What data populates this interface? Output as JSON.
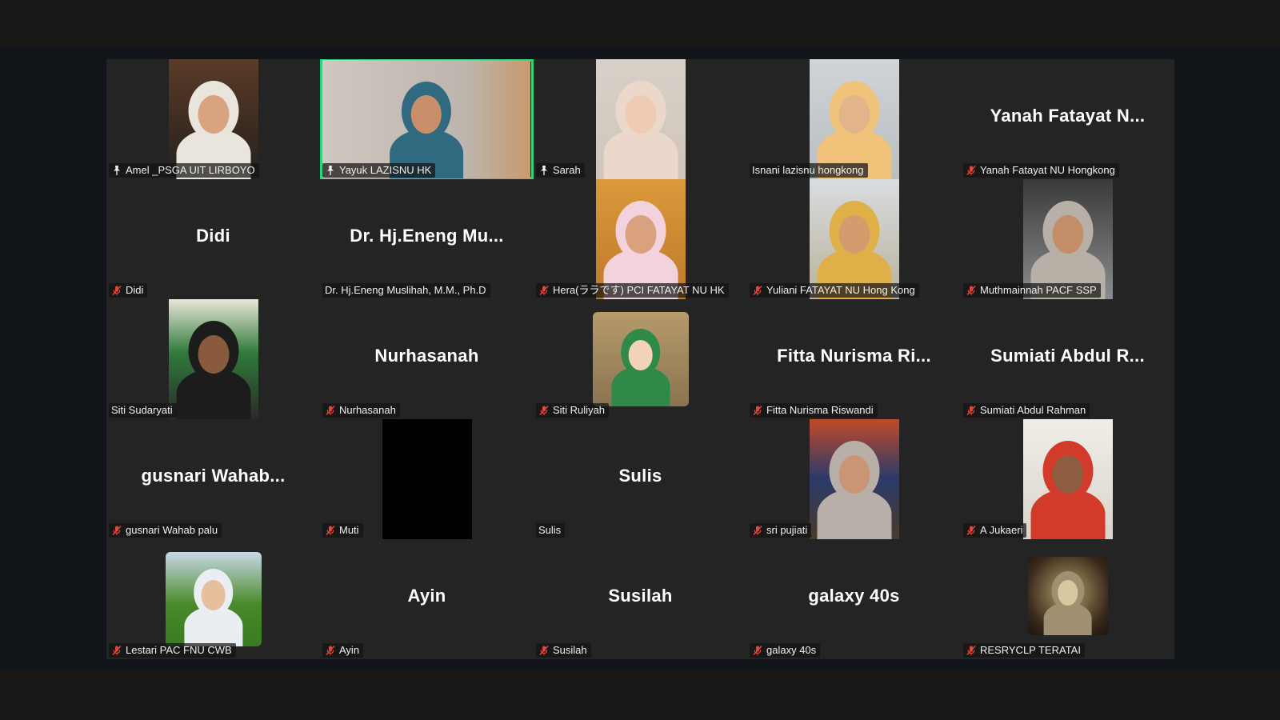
{
  "colors": {
    "active_speaker": "#2ad47a",
    "mute": "#e0463c",
    "tile_bg": "#242424"
  },
  "participants": [
    {
      "label": "Amel _PSGA UIT LIRBOYO",
      "big": "",
      "icon": "pin-icon",
      "video": "portrait"
    },
    {
      "label": "Yayuk LAZISNU HK",
      "big": "",
      "icon": "pin-icon",
      "video": "wide",
      "active": true
    },
    {
      "label": "Sarah",
      "big": "",
      "icon": "pin-icon",
      "video": "portrait"
    },
    {
      "label": "Isnani lazisnu hongkong",
      "big": "",
      "icon": "",
      "video": "portrait"
    },
    {
      "label": "Yanah Fatayat NU Hongkong",
      "big": "Yanah Fatayat N...",
      "icon": "mic-off-icon",
      "video": ""
    },
    {
      "label": "Didi",
      "big": "Didi",
      "icon": "mic-off-icon",
      "video": ""
    },
    {
      "label": "Dr. Hj.Eneng Muslihah, M.M., Ph.D",
      "big": "Dr. Hj.Eneng Mu...",
      "icon": "",
      "video": ""
    },
    {
      "label": "Hera(ララです) PCI FATAYAT NU HK",
      "big": "",
      "icon": "mic-off-icon",
      "video": "portrait"
    },
    {
      "label": "Yuliani FATAYAT NU Hong Kong",
      "big": "",
      "icon": "mic-off-icon",
      "video": "portrait"
    },
    {
      "label": "Muthmainnah PACF SSP",
      "big": "",
      "icon": "mic-off-icon",
      "video": "portrait"
    },
    {
      "label": "Siti Sudaryati",
      "big": "",
      "icon": "",
      "video": "portrait"
    },
    {
      "label": "Nurhasanah",
      "big": "Nurhasanah",
      "icon": "mic-off-icon",
      "video": ""
    },
    {
      "label": "Siti Ruliyah",
      "big": "",
      "icon": "mic-off-icon",
      "video": "square"
    },
    {
      "label": "Fitta Nurisma Riswandi",
      "big": "Fitta Nurisma Ri...",
      "icon": "mic-off-icon",
      "video": ""
    },
    {
      "label": "Sumiati Abdul Rahman",
      "big": "Sumiati Abdul R...",
      "icon": "mic-off-icon",
      "video": ""
    },
    {
      "label": "gusnari Wahab palu",
      "big": "gusnari Wahab...",
      "icon": "mic-off-icon",
      "video": ""
    },
    {
      "label": "Muti",
      "big": "",
      "icon": "mic-off-icon",
      "video": "black"
    },
    {
      "label": "Sulis",
      "big": "Sulis",
      "icon": "",
      "video": ""
    },
    {
      "label": "sri pujiati",
      "big": "",
      "icon": "mic-off-icon",
      "video": "portrait"
    },
    {
      "label": "A Jukaeri",
      "big": "",
      "icon": "mic-off-icon",
      "video": "portrait"
    },
    {
      "label": "Lestari PAC FNU CWB",
      "big": "",
      "icon": "mic-off-icon",
      "video": "square"
    },
    {
      "label": "Ayin",
      "big": "Ayin",
      "icon": "mic-off-icon",
      "video": ""
    },
    {
      "label": "Susilah",
      "big": "Susilah",
      "icon": "mic-off-icon",
      "video": ""
    },
    {
      "label": "galaxy 40s",
      "big": "galaxy 40s",
      "icon": "mic-off-icon",
      "video": ""
    },
    {
      "label": "RESRYCLP TERATAI",
      "big": "",
      "icon": "mic-off-icon",
      "video": "small-sq"
    }
  ]
}
